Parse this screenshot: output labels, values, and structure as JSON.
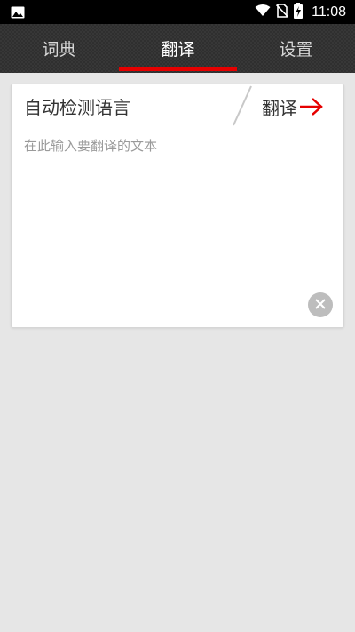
{
  "status_bar": {
    "time": "11:08",
    "icons": [
      "image-icon",
      "wifi-icon",
      "no-sim-icon",
      "battery-charging-icon"
    ]
  },
  "tabs": [
    {
      "label": "词典",
      "active": false
    },
    {
      "label": "翻译",
      "active": true
    },
    {
      "label": "设置",
      "active": false
    }
  ],
  "translate_card": {
    "source_language": "自动检测语言",
    "translate_label": "翻译",
    "input_value": "",
    "input_placeholder": "在此输入要翻译的文本"
  },
  "colors": {
    "accent": "#e60000",
    "tab_bar_bg": "#2f2f2f",
    "page_bg": "#e6e6e6"
  }
}
